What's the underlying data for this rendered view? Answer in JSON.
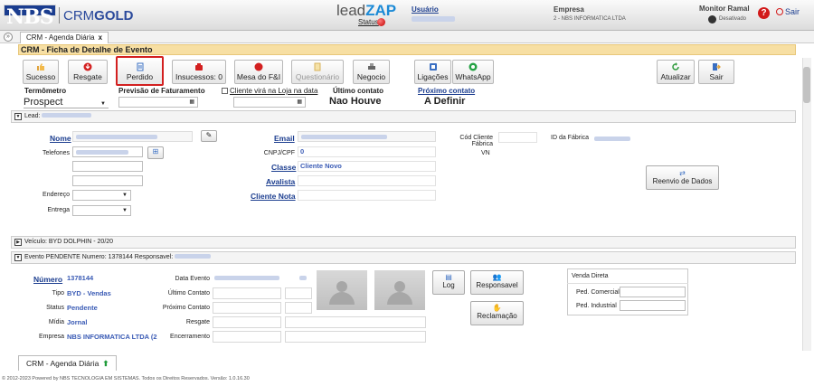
{
  "header": {
    "logo_nbs": "NBS",
    "logo_crm": "CRM",
    "logo_gold": "GOLD",
    "leadzap_a": "lead",
    "leadzap_b": "ZAP",
    "status_label": "Status",
    "usuario_label": "Usuário",
    "empresa_label": "Empresa",
    "empresa_value": "2 - NBS INFORMATICA LTDA",
    "monitor_label": "Monitor Ramal",
    "monitor_value": "Desativado",
    "help": "?",
    "sair": "Sair"
  },
  "tabs": {
    "toggle": "»",
    "top_tab": "CRM - Agenda Diária",
    "close": "x",
    "bottom_tab": "CRM - Agenda Diária"
  },
  "title": "CRM - Ficha de Detalhe de Evento",
  "toolbar": {
    "sucesso": "Sucesso",
    "resgate": "Resgate",
    "perdido": "Perdido",
    "insucessos": "Insucessos: 0",
    "mesa": "Mesa do F&I",
    "questionario": "Questionário",
    "negocio": "Negocio",
    "ligacoes": "Ligações",
    "whatsapp": "WhatsApp",
    "atualizar": "Atualizar",
    "sair": "Sair"
  },
  "fields": {
    "termometro_label": "Termômetro",
    "termometro_value": "Prospect",
    "previsao_label": "Previsão de Faturamento",
    "cliente_loja_label": "Cliente virá na Loja na data",
    "ultimo_label": "Último contato",
    "ultimo_value": "Nao Houve",
    "proximo_label": "Próximo contato",
    "proximo_value": "A Definir"
  },
  "lead": {
    "section": "Lead:",
    "nome": "Nome",
    "telefones": "Telefones",
    "endereco": "Endereço",
    "entrega": "Entrega",
    "email": "Email",
    "cnpj": "CNPJ/CPF",
    "cnpj_value": "0",
    "classe": "Classe",
    "classe_value": "Cliente Novo",
    "avalista": "Avalista",
    "cliente_nota": "Cliente Nota",
    "cod_fabrica": "Cód Cliente Fábrica",
    "vn": "VN",
    "id_fabrica": "ID da Fábrica",
    "reenvio": "Reenvio de Dados"
  },
  "veiculo": {
    "section": "Veículo: BYD DOLPHIN - 20/20"
  },
  "evento": {
    "section": "Evento PENDENTE Numero: 1378144 Responsavel:",
    "numero_label": "Número",
    "numero_value": "1378144",
    "tipo_label": "Tipo",
    "tipo_value": "BYD - Vendas",
    "status_label": "Status",
    "status_value": "Pendente",
    "midia_label": "Mídia",
    "midia_value": "Jornal",
    "empresa_label": "Empresa",
    "empresa_value": "NBS INFORMATICA LTDA (2",
    "data_evento": "Data Evento",
    "ultimo_contato": "Último Contato",
    "proximo_contato": "Próximo Contato",
    "resgate": "Resgate",
    "encerramento": "Encerramento",
    "log": "Log",
    "responsavel": "Responsavel",
    "reclamacao": "Reclamação",
    "venda_direta": "Venda Direta",
    "ped_comercial": "Ped. Comercial",
    "ped_industrial": "Ped. Industrial"
  },
  "footer": "© 2012-2023 Powered by NBS TECNOLOGIA EM SISTEMAS. Todos os Direitos Reservados.   Versão: 1.0.16.30"
}
